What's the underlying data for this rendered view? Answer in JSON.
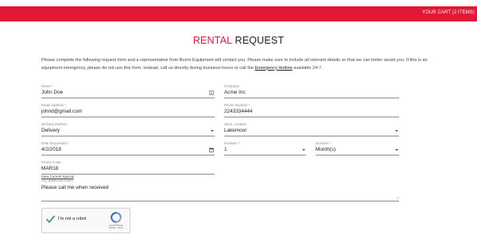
{
  "header": {
    "cart_label": "YOUR CART (2 ITEMS)",
    "brand_color": "#e31837"
  },
  "title": {
    "accent": "RENTAL",
    "rest": " REQUEST"
  },
  "intro": {
    "text_before": "Please complete the following request form and a representative from Burris Equipment will contact you. Please make sure to include all relevant details so that we can better assist you. If this is an equipment emergency, please do not use this form. Instead, call us directly during business hours or call the ",
    "hotline": "Emergency Hotline",
    "text_after": " available 24-7."
  },
  "form": {
    "name": {
      "label": "Name *",
      "value": "John Doe",
      "icon": "contact-card-icon"
    },
    "company": {
      "label": "Company",
      "value": "Acme Inc"
    },
    "email": {
      "label": "Email Address *",
      "value": "johnd@gmail.com"
    },
    "phone": {
      "label": "Phone Number *",
      "value": "2243334444"
    },
    "delivery_method": {
      "label": "Delivery Method",
      "value": "Delivery"
    },
    "store_location": {
      "label": "Store Location",
      "value": "Lakemoor"
    },
    "date_requested": {
      "label": "Date Requested *",
      "value": "4/2/2018",
      "icon": "calendar-icon"
    },
    "duration_count": {
      "label": "Duration *",
      "value": "1"
    },
    "duration_unit": {
      "label": "Duration *",
      "value": "Month(s)"
    },
    "promo_code": {
      "label": "Promo Code",
      "value": "MAR18"
    },
    "view_coupon": "View Current Special",
    "notes": {
      "label": "Any additional notes",
      "value": "Please call me when received"
    }
  },
  "recaptcha": {
    "label": "I'm not a robot",
    "brand": "reCAPTCHA",
    "links": "Privacy - Terms",
    "checked": true
  }
}
